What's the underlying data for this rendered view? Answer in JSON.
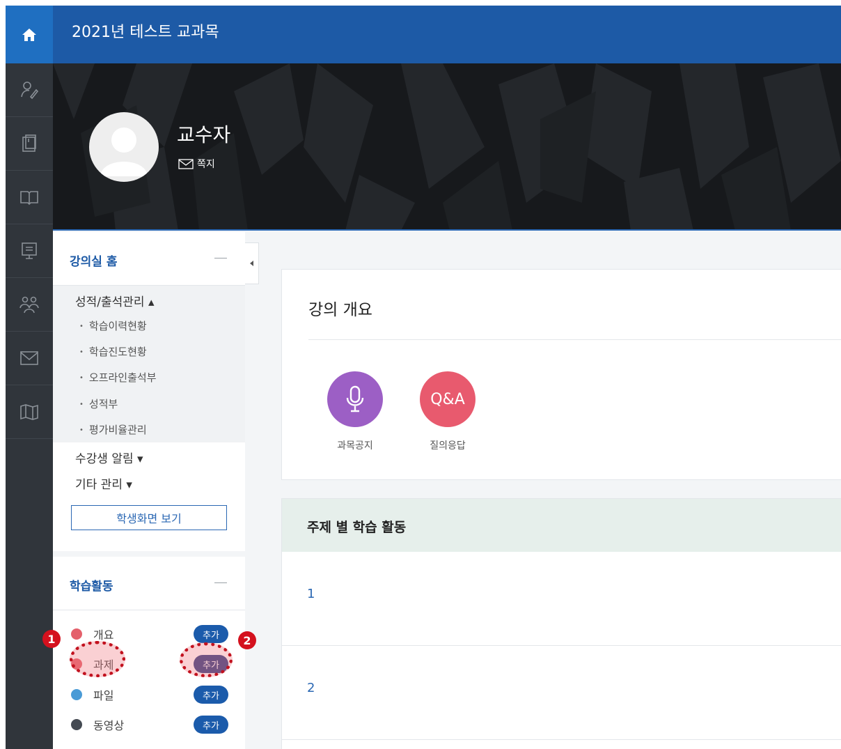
{
  "header": {
    "course_title": "2021년 테스트 교과목"
  },
  "rail": {
    "items": [
      {
        "icon": "person-edit-icon"
      },
      {
        "icon": "notebook-icon"
      },
      {
        "icon": "open-book-icon"
      },
      {
        "icon": "presentation-icon"
      },
      {
        "icon": "people-group-icon"
      },
      {
        "icon": "envelope-icon"
      },
      {
        "icon": "map-icon"
      }
    ]
  },
  "profile": {
    "name": "교수자",
    "message_link": "쪽지"
  },
  "sidebar": {
    "home_panel": {
      "title": "강의실 홈",
      "grade_menu": "성적/출석관리 ▴",
      "grade_items": [
        "학습이력현황",
        "학습진도현황",
        "오프라인출석부",
        "성적부",
        "평가비율관리"
      ],
      "notify_menu": "수강생 알림 ▾",
      "etc_menu": "기타 관리 ▾",
      "student_view_button": "학생화면 보기"
    },
    "activity_panel": {
      "title": "학습활동",
      "items": [
        {
          "label": "개요",
          "add": "추가",
          "color": "#e4606b"
        },
        {
          "label": "과제",
          "add": "추가",
          "color": "#e4606b"
        },
        {
          "label": "파일",
          "add": "추가",
          "color": "#4a9bd6"
        },
        {
          "label": "동영상",
          "add": "추가",
          "color": "#444a52"
        }
      ]
    }
  },
  "overview": {
    "title": "강의 개요",
    "quick_links": [
      {
        "label": "과목공지",
        "color": "#9c5fc5",
        "icon": "microphone-icon"
      },
      {
        "label": "질의응답",
        "color": "#e85a6e",
        "icon_text": "Q&A"
      }
    ]
  },
  "topics": {
    "title": "주제 별 학습 활동",
    "rows": [
      "1",
      "2"
    ]
  },
  "annotations": {
    "badge1": "1",
    "badge2": "2"
  }
}
